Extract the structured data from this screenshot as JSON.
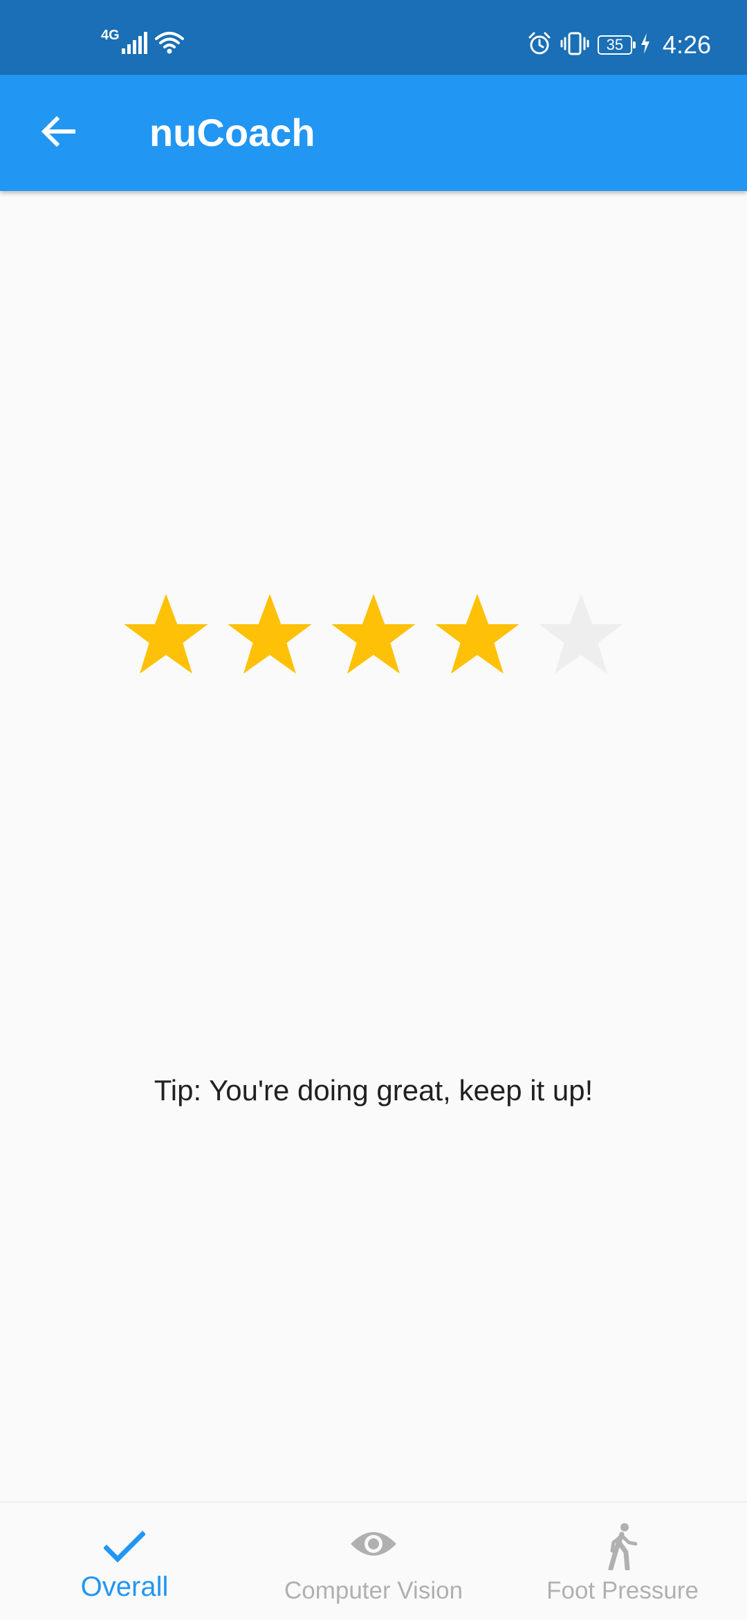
{
  "status_bar": {
    "network": "4G",
    "battery": "35",
    "time": "4:26"
  },
  "app_bar": {
    "title": "nuCoach"
  },
  "rating": {
    "value": 4,
    "max": 5,
    "filled_color": "#ffc107",
    "empty_color": "#eeeeee"
  },
  "tip": {
    "text": "Tip: You're doing great, keep it up!"
  },
  "bottom_nav": {
    "active_color": "#2196f3",
    "inactive_color": "#b0b0b0",
    "items": [
      {
        "label": "Overall",
        "icon": "check-icon",
        "active": true
      },
      {
        "label": "Computer Vision",
        "icon": "eye-icon",
        "active": false
      },
      {
        "label": "Foot Pressure",
        "icon": "walking-icon",
        "active": false
      }
    ]
  },
  "colors": {
    "status_bar": "#1a6fb6",
    "app_bar": "#2196f3",
    "background": "#fafafa"
  }
}
